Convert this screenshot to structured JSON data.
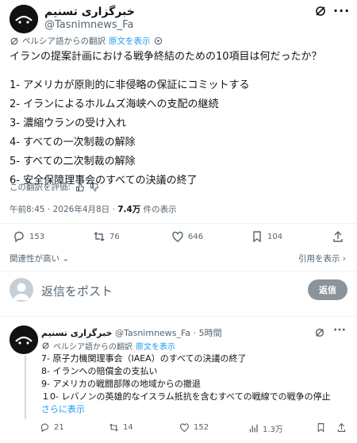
{
  "main_post": {
    "display_name": "خبرگزاری تسنیم",
    "handle": "@Tasnimnews_Fa",
    "translated_from": "ペルシア語からの翻訳",
    "show_original": "原文を表示",
    "title_line": "イランの提案計画における戦争終結のための10項目は何だったか？",
    "lines": [
      "1- アメリカが原則的に非侵略の保証にコミットする",
      "2- イランによるホルムズ海峡への支配の継続",
      "3- 濃縮ウランの受け入れ",
      "4- すべての一次制裁の解除",
      "5- すべての二次制裁の解除",
      "6- 安全保障理事会のすべての決議の終了"
    ],
    "rate_translation": "この翻訳を評価:",
    "time_date": "午前8:45 · 2026年4月8日 · ",
    "views_count": "7.4万",
    "views_label": " 件の表示",
    "actions": {
      "replies": "153",
      "reposts": "76",
      "likes": "646",
      "bookmarks": "104"
    }
  },
  "sort": {
    "relevance_label": "関連性が高い",
    "quotes_label": "引用を表示"
  },
  "composer": {
    "placeholder": "返信をポスト",
    "reply_button": "返信"
  },
  "reply_post": {
    "display_name": "خبرگزاری تسنیم",
    "handle": "@Tasnimnews_Fa",
    "time": "· 5時間",
    "translated_from": "ペルシア語からの翻訳",
    "show_original": "原文を表示",
    "lines": [
      "7- 原子力機関理事会（IAEA）のすべての決議の終了",
      "8- イランへの賠償金の支払い",
      "9- アメリカの戦闘部隊の地域からの撤退",
      "１0- レバノンの英雄的なイスラム抵抗を含むすべての戦線での戦争の停止"
    ],
    "show_more": "さらに表示",
    "actions": {
      "replies": "21",
      "reposts": "14",
      "likes": "152",
      "views": "1.3万"
    }
  }
}
